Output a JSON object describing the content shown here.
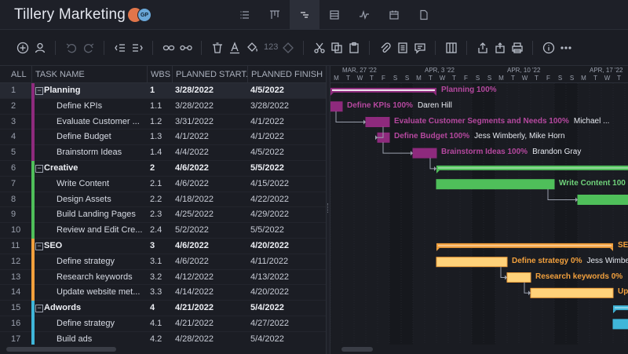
{
  "header": {
    "title": "Tillery Marketing",
    "avatars": [
      "",
      "GP"
    ],
    "views": [
      {
        "name": "list-view",
        "active": false
      },
      {
        "name": "board-view",
        "active": false
      },
      {
        "name": "gantt-view",
        "active": true
      },
      {
        "name": "sheet-view",
        "active": false
      },
      {
        "name": "dashboard-view",
        "active": false
      },
      {
        "name": "calendar-view",
        "active": false
      },
      {
        "name": "files-view",
        "active": false
      }
    ]
  },
  "toolbar": {
    "font_size_label": "123"
  },
  "grid": {
    "columns": [
      "ALL",
      "TASK NAME",
      "WBS",
      "PLANNED START...",
      "PLANNED FINISH ..."
    ],
    "rows": [
      {
        "num": "1",
        "name": "Planning",
        "wbs": "1",
        "start": "3/28/2022",
        "finish": "4/5/2022",
        "parent": true,
        "color": "#8e2a7d"
      },
      {
        "num": "2",
        "name": "Define KPIs",
        "wbs": "1.1",
        "start": "3/28/2022",
        "finish": "3/28/2022",
        "parent": false,
        "color": "#8e2a7d"
      },
      {
        "num": "3",
        "name": "Evaluate Customer ...",
        "wbs": "1.2",
        "start": "3/31/2022",
        "finish": "4/1/2022",
        "parent": false,
        "color": "#8e2a7d"
      },
      {
        "num": "4",
        "name": "Define Budget",
        "wbs": "1.3",
        "start": "4/1/2022",
        "finish": "4/1/2022",
        "parent": false,
        "color": "#8e2a7d"
      },
      {
        "num": "5",
        "name": "Brainstorm Ideas",
        "wbs": "1.4",
        "start": "4/4/2022",
        "finish": "4/5/2022",
        "parent": false,
        "color": "#8e2a7d"
      },
      {
        "num": "6",
        "name": "Creative",
        "wbs": "2",
        "start": "4/6/2022",
        "finish": "5/5/2022",
        "parent": true,
        "color": "#4fbf5a"
      },
      {
        "num": "7",
        "name": "Write Content",
        "wbs": "2.1",
        "start": "4/6/2022",
        "finish": "4/15/2022",
        "parent": false,
        "color": "#4fbf5a"
      },
      {
        "num": "8",
        "name": "Design Assets",
        "wbs": "2.2",
        "start": "4/18/2022",
        "finish": "4/22/2022",
        "parent": false,
        "color": "#4fbf5a"
      },
      {
        "num": "9",
        "name": "Build Landing Pages",
        "wbs": "2.3",
        "start": "4/25/2022",
        "finish": "4/29/2022",
        "parent": false,
        "color": "#4fbf5a"
      },
      {
        "num": "10",
        "name": "Review and Edit Cre...",
        "wbs": "2.4",
        "start": "5/2/2022",
        "finish": "5/5/2022",
        "parent": false,
        "color": "#4fbf5a"
      },
      {
        "num": "11",
        "name": "SEO",
        "wbs": "3",
        "start": "4/6/2022",
        "finish": "4/20/2022",
        "parent": true,
        "color": "#f2a03d"
      },
      {
        "num": "12",
        "name": "Define strategy",
        "wbs": "3.1",
        "start": "4/6/2022",
        "finish": "4/11/2022",
        "parent": false,
        "color": "#f2a03d"
      },
      {
        "num": "13",
        "name": "Research keywords",
        "wbs": "3.2",
        "start": "4/12/2022",
        "finish": "4/13/2022",
        "parent": false,
        "color": "#f2a03d"
      },
      {
        "num": "14",
        "name": "Update website met...",
        "wbs": "3.3",
        "start": "4/14/2022",
        "finish": "4/20/2022",
        "parent": false,
        "color": "#f2a03d"
      },
      {
        "num": "15",
        "name": "Adwords",
        "wbs": "4",
        "start": "4/21/2022",
        "finish": "5/4/2022",
        "parent": true,
        "color": "#3fb6d9"
      },
      {
        "num": "16",
        "name": "Define strategy",
        "wbs": "4.1",
        "start": "4/21/2022",
        "finish": "4/27/2022",
        "parent": false,
        "color": "#3fb6d9"
      },
      {
        "num": "17",
        "name": "Build ads",
        "wbs": "4.2",
        "start": "4/28/2022",
        "finish": "5/4/2022",
        "parent": false,
        "color": "#3fb6d9"
      }
    ]
  },
  "gantt": {
    "weeks": [
      "MAR, 27 '22",
      "APR, 3 '22",
      "APR, 10 '22",
      "APR, 17 '22"
    ],
    "day_letters": [
      "M",
      "T",
      "W",
      "T",
      "F",
      "S",
      "S",
      "M",
      "T",
      "W",
      "T",
      "F",
      "S",
      "S",
      "M",
      "T",
      "W",
      "T",
      "F",
      "S",
      "S",
      "M",
      "T",
      "W",
      "T",
      "F"
    ],
    "colors": {
      "planning": "#8e2a7d",
      "planning_light": "#b5489f",
      "creative": "#4fbf5a",
      "seo": "#f2a03d",
      "seo_light": "#ffd27a",
      "adwords": "#3fb6d9"
    },
    "labels": [
      {
        "row": 0,
        "text": "Planning  100%",
        "assign": "",
        "color": "#b5489f"
      },
      {
        "row": 1,
        "text": "Define KPIs  100%",
        "assign": "Daren Hill",
        "color": "#b5489f"
      },
      {
        "row": 2,
        "text": "Evaluate Customer Segments and Needs  100%",
        "assign": "Michael ...",
        "color": "#b5489f"
      },
      {
        "row": 3,
        "text": "Define Budget  100%",
        "assign": "Jess Wimberly, Mike Horn",
        "color": "#b5489f"
      },
      {
        "row": 4,
        "text": "Brainstorm Ideas  100%",
        "assign": "Brandon Gray",
        "color": "#b5489f"
      },
      {
        "row": 6,
        "text": "Write Content  100",
        "assign": "",
        "color": "#6fd27a"
      },
      {
        "row": 10,
        "text": "SEO",
        "assign": "",
        "color": "#f2a03d"
      },
      {
        "row": 11,
        "text": "Define strategy  0%",
        "assign": "Jess Wimbe",
        "color": "#f2a03d"
      },
      {
        "row": 12,
        "text": "Research keywords  0%",
        "assign": "",
        "color": "#f2a03d"
      },
      {
        "row": 13,
        "text": "Upd",
        "assign": "",
        "color": "#f2a03d"
      }
    ]
  }
}
